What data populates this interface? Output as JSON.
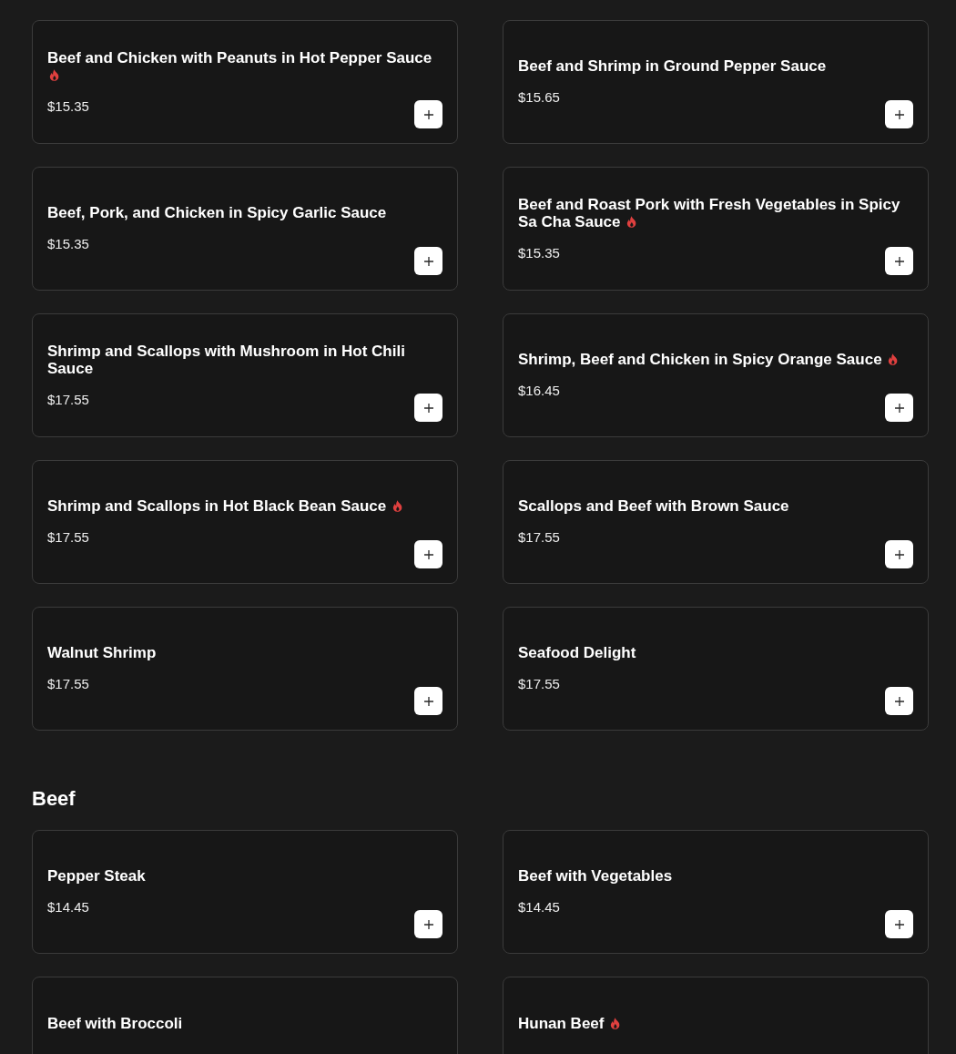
{
  "sections": [
    {
      "items": [
        {
          "name": "Beef and Chicken with Peanuts in Hot Pepper Sauce",
          "price": "$15.35",
          "spicy": true
        },
        {
          "name": "Beef and Shrimp in Ground Pepper Sauce",
          "price": "$15.65",
          "spicy": false
        },
        {
          "name": "Beef, Pork, and Chicken in Spicy Garlic Sauce",
          "price": "$15.35",
          "spicy": false
        },
        {
          "name": "Beef and Roast Pork with Fresh Vegetables in Spicy Sa Cha Sauce",
          "price": "$15.35",
          "spicy": true
        },
        {
          "name": "Shrimp and Scallops with Mushroom in Hot Chili Sauce",
          "price": "$17.55",
          "spicy": false
        },
        {
          "name": "Shrimp, Beef and Chicken in Spicy Orange Sauce",
          "price": "$16.45",
          "spicy": true
        },
        {
          "name": "Shrimp and Scallops in Hot Black Bean Sauce",
          "price": "$17.55",
          "spicy": true
        },
        {
          "name": "Scallops and Beef with Brown Sauce",
          "price": "$17.55",
          "spicy": false
        },
        {
          "name": "Walnut Shrimp",
          "price": "$17.55",
          "spicy": false
        },
        {
          "name": "Seafood Delight",
          "price": "$17.55",
          "spicy": false
        }
      ]
    },
    {
      "title": "Beef",
      "items": [
        {
          "name": "Pepper Steak",
          "price": "$14.45",
          "spicy": false
        },
        {
          "name": "Beef with Vegetables",
          "price": "$14.45",
          "spicy": false
        },
        {
          "name": "Beef with Broccoli",
          "spicy": false
        },
        {
          "name": "Hunan Beef",
          "spicy": true
        }
      ]
    }
  ]
}
